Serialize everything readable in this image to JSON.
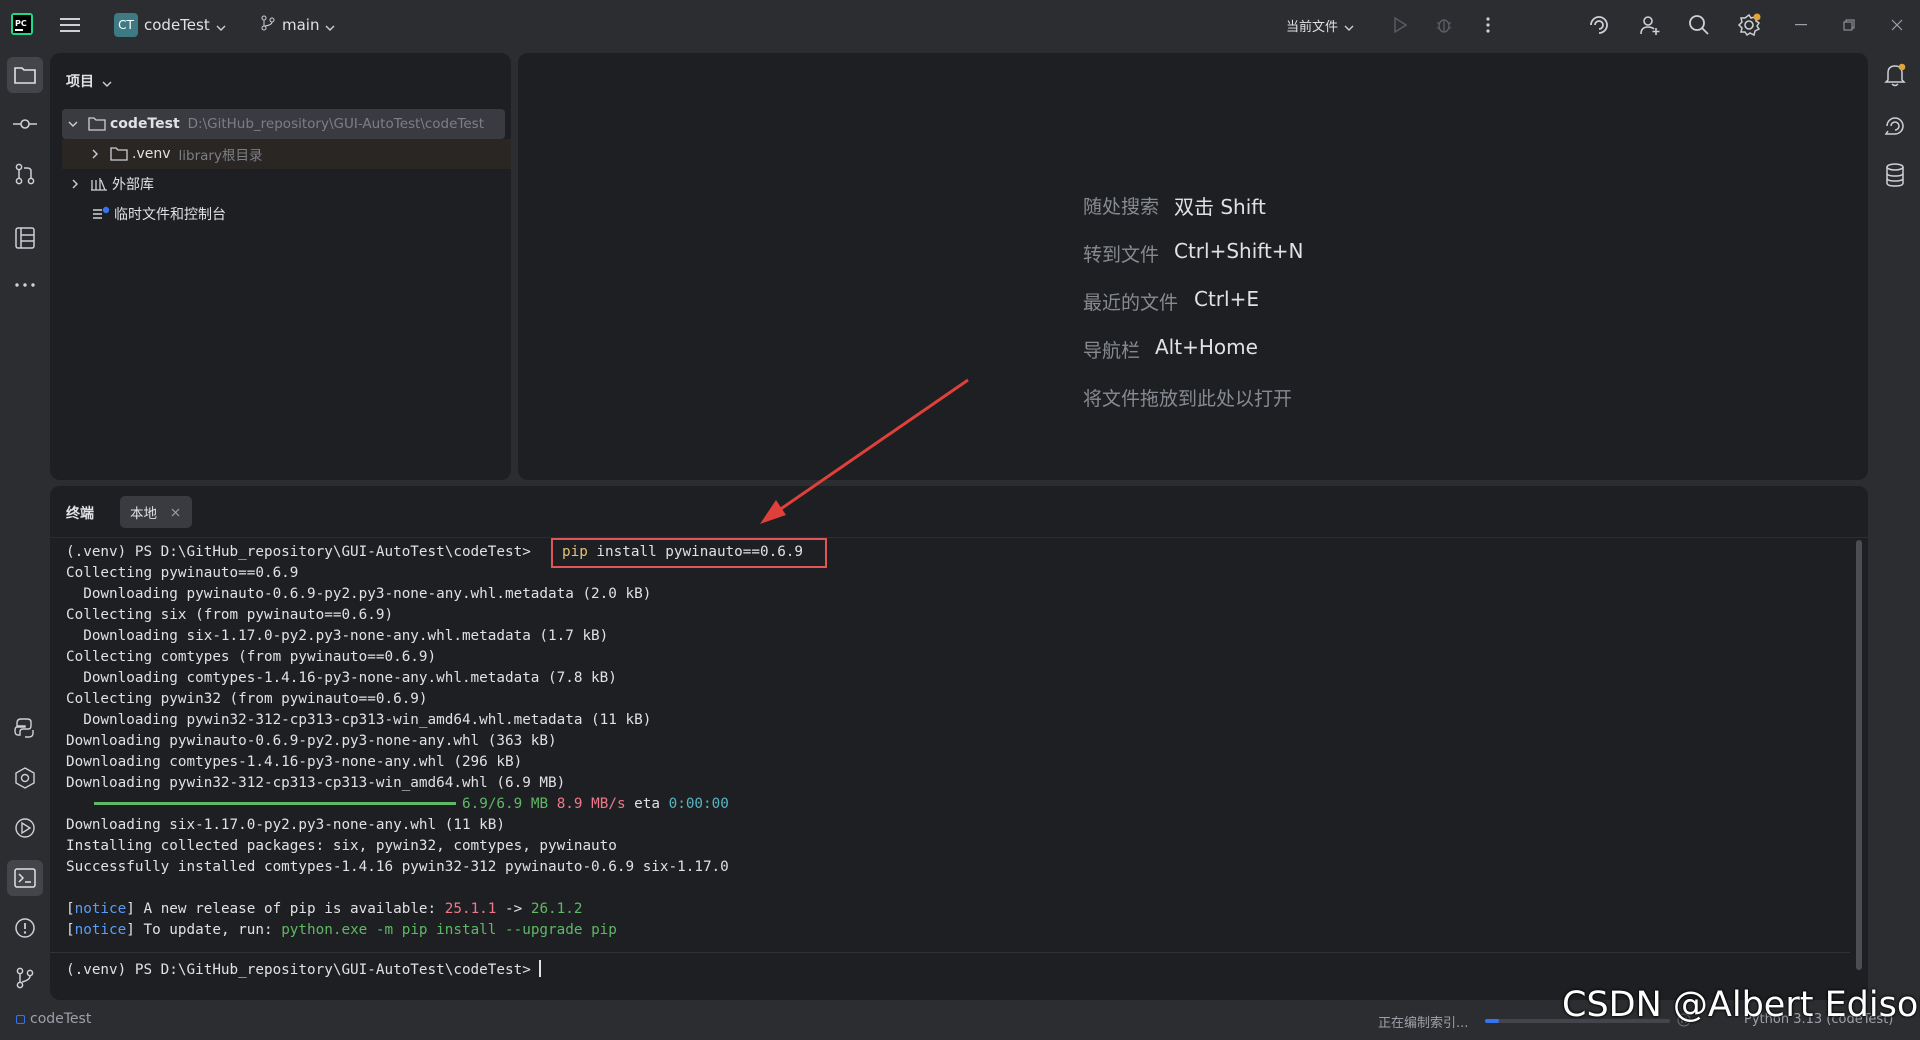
{
  "titlebar": {
    "project_badge": "CT",
    "project_name": "codeTest",
    "branch": "main",
    "run_config": "当前文件"
  },
  "project_panel": {
    "title": "项目",
    "tree": [
      {
        "name": "codeTest",
        "detail": "D:\\GitHub_repository\\GUI-AutoTest\\codeTest"
      },
      {
        "name": ".venv",
        "detail": "library根目录"
      },
      {
        "name": "外部库",
        "detail": ""
      },
      {
        "name": "临时文件和控制台",
        "detail": ""
      }
    ]
  },
  "editor": {
    "hints": [
      {
        "label": "随处搜索",
        "key": "双击 Shift"
      },
      {
        "label": "转到文件",
        "key": "Ctrl+Shift+N"
      },
      {
        "label": "最近的文件",
        "key": "Ctrl+E"
      },
      {
        "label": "导航栏",
        "key": "Alt+Home"
      }
    ],
    "drop_hint": "将文件拖放到此处以打开"
  },
  "terminal": {
    "title": "终端",
    "tab": "本地",
    "prompt": "(.venv) PS D:\\GitHub_repository\\GUI-AutoTest\\codeTest>",
    "command_pip": "pip",
    "command_rest": " install pywinauto==0.6.9",
    "lines": [
      "Collecting pywinauto==0.6.9",
      "  Downloading pywinauto-0.6.9-py2.py3-none-any.whl.metadata (2.0 kB)",
      "Collecting six (from pywinauto==0.6.9)",
      "  Downloading six-1.17.0-py2.py3-none-any.whl.metadata (1.7 kB)",
      "Collecting comtypes (from pywinauto==0.6.9)",
      "  Downloading comtypes-1.4.16-py3-none-any.whl.metadata (7.8 kB)",
      "Collecting pywin32 (from pywinauto==0.6.9)",
      "  Downloading pywin32-312-cp313-cp313-win_amd64.whl.metadata (11 kB)",
      "Downloading pywinauto-0.6.9-py2.py3-none-any.whl (363 kB)",
      "Downloading comtypes-1.4.16-py3-none-any.whl (296 kB)",
      "Downloading pywin32-312-cp313-cp313-win_amd64.whl (6.9 MB)"
    ],
    "progress": {
      "fraction": 1.0,
      "size": "6.9/6.9 MB",
      "speed": "8.9 MB/s",
      "eta_label": "eta",
      "eta": "0:00:00"
    },
    "lines2": [
      "Downloading six-1.17.0-py2.py3-none-any.whl (11 kB)",
      "Installing collected packages: six, pywin32, comtypes, pywinauto",
      "Successfully installed comtypes-1.4.16 pywin32-312 pywinauto-0.6.9 six-1.17.0"
    ],
    "notice1": {
      "tag": "notice",
      "text": " A new release of pip is available: ",
      "old": "25.1.1",
      "arrow": " -> ",
      "new": "26.1.2"
    },
    "notice2": {
      "tag": "notice",
      "text": " To update, run: ",
      "cmd": "python.exe -m pip install --upgrade pip"
    },
    "final_prompt": "(.venv) PS D:\\GitHub_repository\\GUI-AutoTest\\codeTest> "
  },
  "statusbar": {
    "project": "codeTest",
    "indexing": "正在编制索引...",
    "interpreter": "Python 3.13 (codeTest)"
  },
  "watermark": "CSDN @Albert Edison",
  "colors": {
    "accent": "#3574f0",
    "highlight_box": "#e05555",
    "arrow": "#e0403a"
  }
}
